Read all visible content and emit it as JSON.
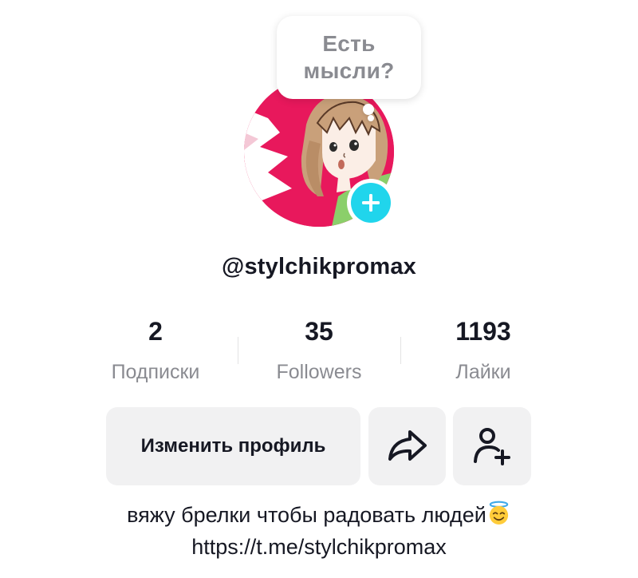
{
  "bubble": {
    "line1": "Есть",
    "line2": "мысли?"
  },
  "profile": {
    "username": "@stylchikpromax",
    "stats": [
      {
        "value": "2",
        "label": "Подписки"
      },
      {
        "value": "35",
        "label": "Followers"
      },
      {
        "value": "1193",
        "label": "Лайки"
      }
    ],
    "edit_button_label": "Изменить профиль",
    "bio_text": "вяжу брелки чтобы радовать людей",
    "bio_emoji": "smiling-face-with-halo",
    "bio_link": "https://t.me/stylchikpromax"
  },
  "icons": {
    "avatar_add": "plus-icon",
    "share": "share-arrow-icon",
    "add_friend": "add-friend-icon"
  },
  "colors": {
    "accent_cyan": "#20d5ec",
    "button_bg": "#f1f1f2",
    "secondary_text": "#8a8b91",
    "avatar_bg": "#e8185c"
  }
}
